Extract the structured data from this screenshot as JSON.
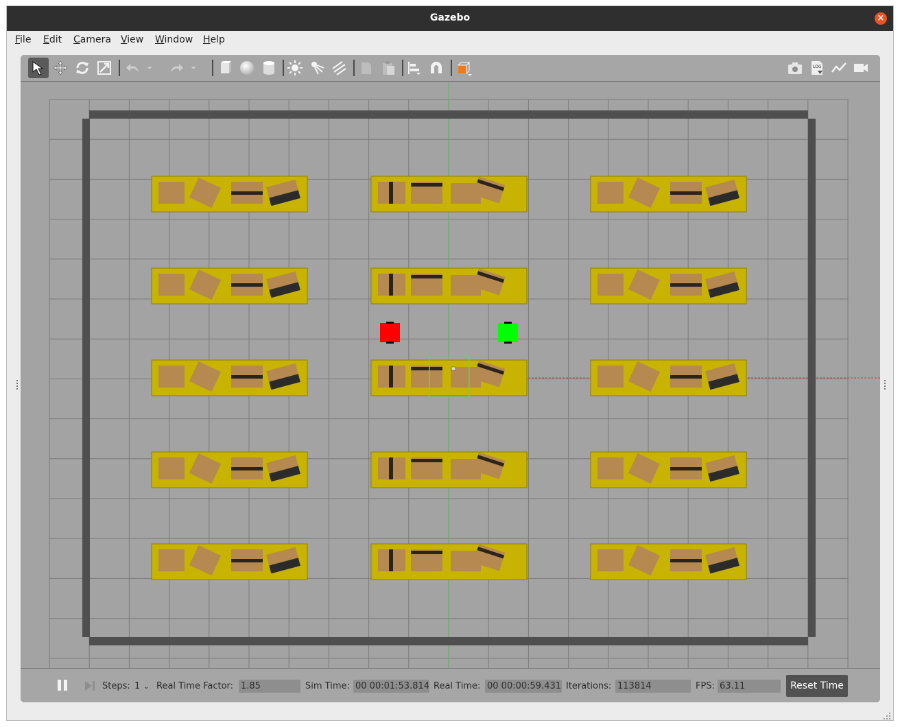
{
  "window": {
    "title": "Gazebo",
    "close_label": "×"
  },
  "menu": [
    {
      "accel": "F",
      "rest": "ile"
    },
    {
      "accel": "E",
      "rest": "dit"
    },
    {
      "accel": "C",
      "rest": "amera"
    },
    {
      "accel": "V",
      "rest": "iew"
    },
    {
      "accel": "W",
      "rest": "indow"
    },
    {
      "accel": "H",
      "rest": "elp"
    }
  ],
  "toolbar_left": [
    "select-mode-icon",
    "translate-mode-icon",
    "rotate-mode-icon",
    "scale-mode-icon",
    "undo-icon",
    "undo-history-icon",
    "redo-icon",
    "redo-history-icon",
    "box-shape-icon",
    "sphere-shape-icon",
    "cylinder-shape-icon",
    "point-light-icon",
    "spot-light-icon",
    "directional-light-icon",
    "copy-icon",
    "paste-icon",
    "align-icon",
    "snap-icon",
    "view-angle-icon"
  ],
  "toolbar_right": [
    "screenshot-icon",
    "log-icon",
    "plot-icon",
    "video-record-icon"
  ],
  "bottom": {
    "steps_label": "Steps:",
    "steps_value": "1",
    "rtf_label": "Real Time Factor:",
    "rtf_value": "1.85",
    "sim_time_label": "Sim Time:",
    "sim_time_value": "00 00:01:53.814",
    "real_time_label": "Real Time:",
    "real_time_value": "00 00:00:59.431",
    "iterations_label": "Iterations:",
    "iterations_value": "113814",
    "fps_label": "FPS:",
    "fps_value": "63.11",
    "reset_label": "Reset Time"
  },
  "scene": {
    "shelf_rows": 5,
    "shelf_columns": 3,
    "robots": [
      {
        "name": "red-robot",
        "color": "#ff0000"
      },
      {
        "name": "green-robot",
        "color": "#00ff00"
      }
    ],
    "shelf_color": "#c8b400",
    "box_color": "#b5894f",
    "wall_color": "#4f4f4f",
    "ground_color": "#a3a3a3",
    "grid_color": "#7b7b7b"
  }
}
